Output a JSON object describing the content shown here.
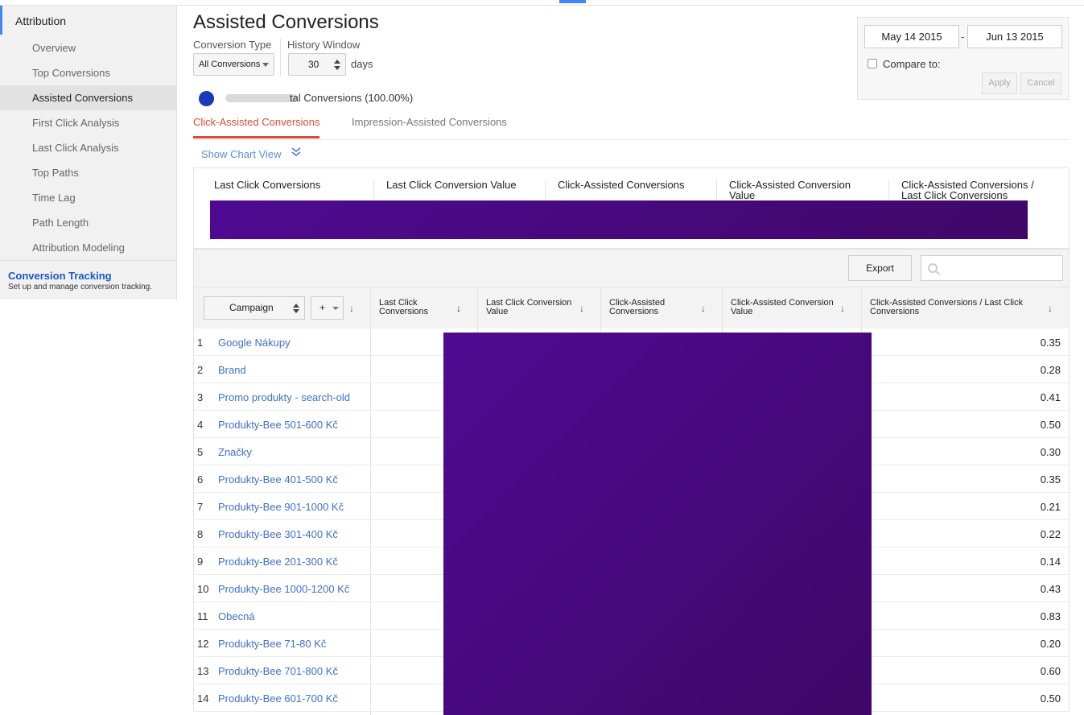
{
  "sidebar": {
    "header": "Attribution",
    "items": [
      {
        "label": "Overview"
      },
      {
        "label": "Top Conversions"
      },
      {
        "label": "Assisted Conversions"
      },
      {
        "label": "First Click Analysis"
      },
      {
        "label": "Last Click Analysis"
      },
      {
        "label": "Top Paths"
      },
      {
        "label": "Time Lag"
      },
      {
        "label": "Path Length"
      },
      {
        "label": "Attribution Modeling"
      }
    ],
    "active_index": 2,
    "conversion_tracking": {
      "link": "Conversion Tracking",
      "desc": "Set up and manage conversion tracking."
    }
  },
  "header": {
    "title": "Assisted Conversions",
    "conversion_type_label": "Conversion Type",
    "conversion_type_value": "All Conversions",
    "history_window_label": "History Window",
    "history_window_value": "30",
    "history_unit": "days",
    "segment_text": "tal Conversions (100.00%)"
  },
  "tabs": [
    {
      "label": "Click-Assisted Conversions",
      "active": true
    },
    {
      "label": "Impression-Assisted Conversions",
      "active": false
    }
  ],
  "show_chart_label": "Show Chart View",
  "date_range": {
    "start": "May 14 2015",
    "separator": "-",
    "end": "Jun 13 2015",
    "compare_label": "Compare to:",
    "apply": "Apply",
    "cancel": "Cancel"
  },
  "summary": {
    "labels": [
      "Last Click Conversions",
      "Last Click Conversion Value",
      "Click-Assisted Conversions",
      "Click-Assisted Conversion Value",
      "Click-Assisted Conversions / Last Click Conversions"
    ]
  },
  "table": {
    "export_label": "Export",
    "primary_dimension": "Campaign",
    "add_dimension": "+",
    "columns": [
      "Last Click Conversions",
      "Last Click Conversion Value",
      "Click-Assisted Conversions",
      "Click-Assisted Conversion Value",
      "Click-Assisted Conversions / Last Click Conversions"
    ],
    "rows": [
      {
        "num": "1",
        "campaign": "Google Nákupy",
        "ratio": "0.35"
      },
      {
        "num": "2",
        "campaign": "Brand",
        "ratio": "0.28"
      },
      {
        "num": "3",
        "campaign": "Promo produkty - search-old",
        "ratio": "0.41"
      },
      {
        "num": "4",
        "campaign": "Produkty-Bee 501-600 Kč",
        "ratio": "0.50"
      },
      {
        "num": "5",
        "campaign": "Značky",
        "ratio": "0.30"
      },
      {
        "num": "6",
        "campaign": "Produkty-Bee 401-500 Kč",
        "ratio": "0.35"
      },
      {
        "num": "7",
        "campaign": "Produkty-Bee 901-1000 Kč",
        "ratio": "0.21"
      },
      {
        "num": "8",
        "campaign": "Produkty-Bee 301-400 Kč",
        "ratio": "0.22"
      },
      {
        "num": "9",
        "campaign": "Produkty-Bee 201-300 Kč",
        "ratio": "0.14"
      },
      {
        "num": "10",
        "campaign": "Produkty-Bee 1000-1200 Kč",
        "ratio": "0.43"
      },
      {
        "num": "11",
        "campaign": "Obecná",
        "ratio": "0.83"
      },
      {
        "num": "12",
        "campaign": "Produkty-Bee 71-80 Kč",
        "ratio": "0.20"
      },
      {
        "num": "13",
        "campaign": "Produkty-Bee 701-800 Kč",
        "ratio": "0.60"
      },
      {
        "num": "14",
        "campaign": "Produkty-Bee 601-700 Kč",
        "ratio": "0.50"
      }
    ]
  },
  "colors": {
    "accent": "#4285f4",
    "tab_active": "#dd4b39",
    "link": "#3f6fd1",
    "redaction": "#4a0a86"
  }
}
